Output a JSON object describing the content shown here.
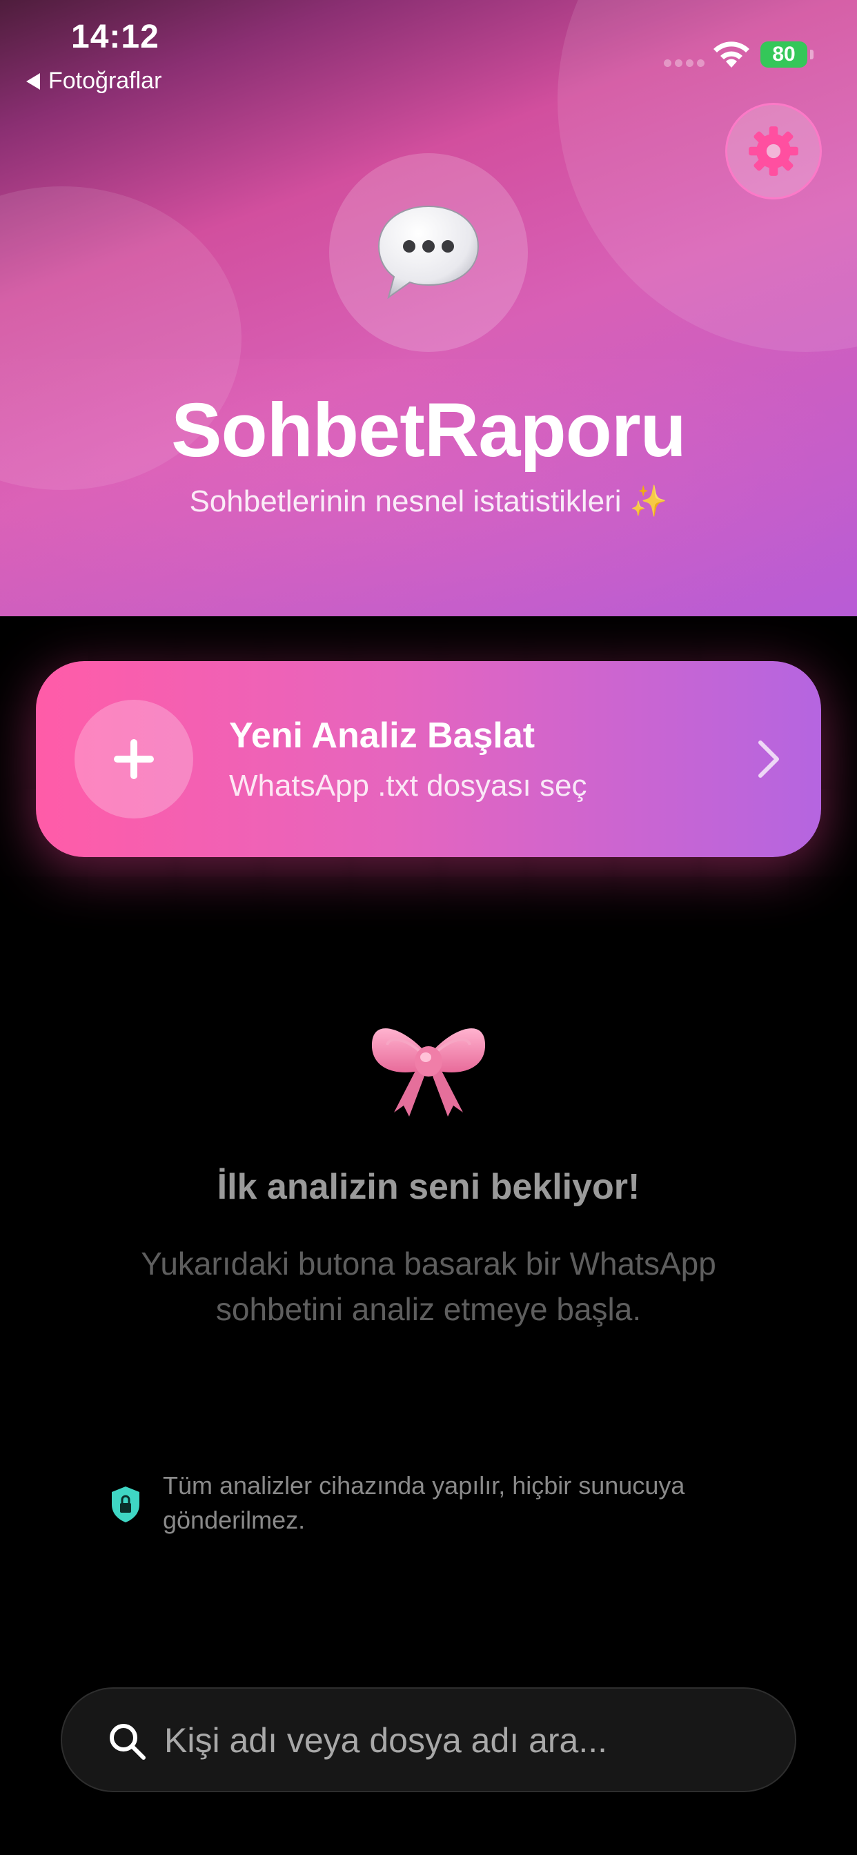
{
  "status_bar": {
    "time": "14:12",
    "back_label": "Fotoğraflar",
    "battery": "80"
  },
  "header": {
    "title": "SohbetRaporu",
    "subtitle": "Sohbetlerinin nesnel istatistikleri ✨",
    "logo_icon": "speech-bubble-icon",
    "settings_icon": "gear-icon"
  },
  "cta": {
    "title": "Yeni Analiz Başlat",
    "subtitle": "WhatsApp .txt dosyası seç"
  },
  "empty_state": {
    "icon": "ribbon-bow-icon",
    "title": "İlk analizin seni bekliyor!",
    "description": "Yukarıdaki butona basarak bir WhatsApp sohbetini analiz etmeye başla."
  },
  "privacy": {
    "text": "Tüm analizler cihazında yapılır, hiçbir sunucuya gönderilmez."
  },
  "search": {
    "placeholder": "Kişi adı veya dosya adı ara...",
    "value": ""
  },
  "colors": {
    "accent_pink": "#ff5ca8",
    "accent_purple": "#b565e0",
    "battery_green": "#34c759",
    "shield_teal": "#3fd6c4"
  }
}
